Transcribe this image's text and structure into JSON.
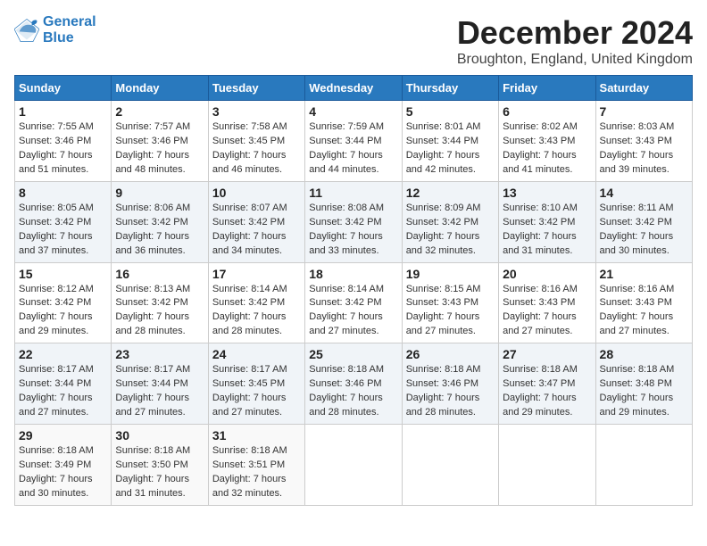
{
  "header": {
    "logo_line1": "General",
    "logo_line2": "Blue",
    "month": "December 2024",
    "location": "Broughton, England, United Kingdom"
  },
  "days_of_week": [
    "Sunday",
    "Monday",
    "Tuesday",
    "Wednesday",
    "Thursday",
    "Friday",
    "Saturday"
  ],
  "weeks": [
    [
      {
        "day": "1",
        "sunrise": "Sunrise: 7:55 AM",
        "sunset": "Sunset: 3:46 PM",
        "daylight": "Daylight: 7 hours and 51 minutes."
      },
      {
        "day": "2",
        "sunrise": "Sunrise: 7:57 AM",
        "sunset": "Sunset: 3:46 PM",
        "daylight": "Daylight: 7 hours and 48 minutes."
      },
      {
        "day": "3",
        "sunrise": "Sunrise: 7:58 AM",
        "sunset": "Sunset: 3:45 PM",
        "daylight": "Daylight: 7 hours and 46 minutes."
      },
      {
        "day": "4",
        "sunrise": "Sunrise: 7:59 AM",
        "sunset": "Sunset: 3:44 PM",
        "daylight": "Daylight: 7 hours and 44 minutes."
      },
      {
        "day": "5",
        "sunrise": "Sunrise: 8:01 AM",
        "sunset": "Sunset: 3:44 PM",
        "daylight": "Daylight: 7 hours and 42 minutes."
      },
      {
        "day": "6",
        "sunrise": "Sunrise: 8:02 AM",
        "sunset": "Sunset: 3:43 PM",
        "daylight": "Daylight: 7 hours and 41 minutes."
      },
      {
        "day": "7",
        "sunrise": "Sunrise: 8:03 AM",
        "sunset": "Sunset: 3:43 PM",
        "daylight": "Daylight: 7 hours and 39 minutes."
      }
    ],
    [
      {
        "day": "8",
        "sunrise": "Sunrise: 8:05 AM",
        "sunset": "Sunset: 3:42 PM",
        "daylight": "Daylight: 7 hours and 37 minutes."
      },
      {
        "day": "9",
        "sunrise": "Sunrise: 8:06 AM",
        "sunset": "Sunset: 3:42 PM",
        "daylight": "Daylight: 7 hours and 36 minutes."
      },
      {
        "day": "10",
        "sunrise": "Sunrise: 8:07 AM",
        "sunset": "Sunset: 3:42 PM",
        "daylight": "Daylight: 7 hours and 34 minutes."
      },
      {
        "day": "11",
        "sunrise": "Sunrise: 8:08 AM",
        "sunset": "Sunset: 3:42 PM",
        "daylight": "Daylight: 7 hours and 33 minutes."
      },
      {
        "day": "12",
        "sunrise": "Sunrise: 8:09 AM",
        "sunset": "Sunset: 3:42 PM",
        "daylight": "Daylight: 7 hours and 32 minutes."
      },
      {
        "day": "13",
        "sunrise": "Sunrise: 8:10 AM",
        "sunset": "Sunset: 3:42 PM",
        "daylight": "Daylight: 7 hours and 31 minutes."
      },
      {
        "day": "14",
        "sunrise": "Sunrise: 8:11 AM",
        "sunset": "Sunset: 3:42 PM",
        "daylight": "Daylight: 7 hours and 30 minutes."
      }
    ],
    [
      {
        "day": "15",
        "sunrise": "Sunrise: 8:12 AM",
        "sunset": "Sunset: 3:42 PM",
        "daylight": "Daylight: 7 hours and 29 minutes."
      },
      {
        "day": "16",
        "sunrise": "Sunrise: 8:13 AM",
        "sunset": "Sunset: 3:42 PM",
        "daylight": "Daylight: 7 hours and 28 minutes."
      },
      {
        "day": "17",
        "sunrise": "Sunrise: 8:14 AM",
        "sunset": "Sunset: 3:42 PM",
        "daylight": "Daylight: 7 hours and 28 minutes."
      },
      {
        "day": "18",
        "sunrise": "Sunrise: 8:14 AM",
        "sunset": "Sunset: 3:42 PM",
        "daylight": "Daylight: 7 hours and 27 minutes."
      },
      {
        "day": "19",
        "sunrise": "Sunrise: 8:15 AM",
        "sunset": "Sunset: 3:43 PM",
        "daylight": "Daylight: 7 hours and 27 minutes."
      },
      {
        "day": "20",
        "sunrise": "Sunrise: 8:16 AM",
        "sunset": "Sunset: 3:43 PM",
        "daylight": "Daylight: 7 hours and 27 minutes."
      },
      {
        "day": "21",
        "sunrise": "Sunrise: 8:16 AM",
        "sunset": "Sunset: 3:43 PM",
        "daylight": "Daylight: 7 hours and 27 minutes."
      }
    ],
    [
      {
        "day": "22",
        "sunrise": "Sunrise: 8:17 AM",
        "sunset": "Sunset: 3:44 PM",
        "daylight": "Daylight: 7 hours and 27 minutes."
      },
      {
        "day": "23",
        "sunrise": "Sunrise: 8:17 AM",
        "sunset": "Sunset: 3:44 PM",
        "daylight": "Daylight: 7 hours and 27 minutes."
      },
      {
        "day": "24",
        "sunrise": "Sunrise: 8:17 AM",
        "sunset": "Sunset: 3:45 PM",
        "daylight": "Daylight: 7 hours and 27 minutes."
      },
      {
        "day": "25",
        "sunrise": "Sunrise: 8:18 AM",
        "sunset": "Sunset: 3:46 PM",
        "daylight": "Daylight: 7 hours and 28 minutes."
      },
      {
        "day": "26",
        "sunrise": "Sunrise: 8:18 AM",
        "sunset": "Sunset: 3:46 PM",
        "daylight": "Daylight: 7 hours and 28 minutes."
      },
      {
        "day": "27",
        "sunrise": "Sunrise: 8:18 AM",
        "sunset": "Sunset: 3:47 PM",
        "daylight": "Daylight: 7 hours and 29 minutes."
      },
      {
        "day": "28",
        "sunrise": "Sunrise: 8:18 AM",
        "sunset": "Sunset: 3:48 PM",
        "daylight": "Daylight: 7 hours and 29 minutes."
      }
    ],
    [
      {
        "day": "29",
        "sunrise": "Sunrise: 8:18 AM",
        "sunset": "Sunset: 3:49 PM",
        "daylight": "Daylight: 7 hours and 30 minutes."
      },
      {
        "day": "30",
        "sunrise": "Sunrise: 8:18 AM",
        "sunset": "Sunset: 3:50 PM",
        "daylight": "Daylight: 7 hours and 31 minutes."
      },
      {
        "day": "31",
        "sunrise": "Sunrise: 8:18 AM",
        "sunset": "Sunset: 3:51 PM",
        "daylight": "Daylight: 7 hours and 32 minutes."
      },
      null,
      null,
      null,
      null
    ]
  ]
}
